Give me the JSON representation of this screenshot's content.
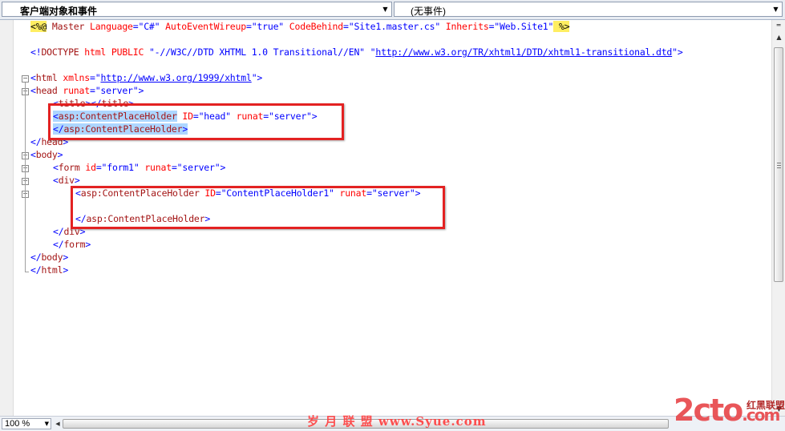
{
  "navbar": {
    "left_dropdown": "客户端对象和事件",
    "right_dropdown": "(无事件)"
  },
  "code": {
    "line1": {
      "open": "<%@",
      "directive": " Master",
      "a1": " Language",
      "v1": "=\"C#\"",
      "a2": " AutoEventWireup",
      "v2": "=\"true\"",
      "a3": " CodeBehind",
      "v3": "=\"Site1.master.cs\"",
      "a4": " Inherits",
      "v4": "=\"Web.Site1\"",
      "close": " %>"
    },
    "line3": {
      "prefix": "<!",
      "tag": "DOCTYPE",
      "rest1": " html",
      "rest2": " PUBLIC",
      "str1": " \"-//W3C//DTD XHTML 1.0 Transitional//EN\"",
      "q_open": " \"",
      "url": "http://www.w3.org/TR/xhtml1/DTD/xhtml1-transitional.dtd",
      "q_close": "\">"
    },
    "line5": {
      "open": "<",
      "tag": "html",
      "attr": " xmlns",
      "eq": "=\"",
      "url": "http://www.w3.org/1999/xhtml",
      "close": "\">"
    },
    "line6": {
      "open": "<",
      "tag": "head",
      "attr": " runat",
      "val": "=\"server\"",
      "close": ">"
    },
    "line7": {
      "open": "<",
      "tag": "title",
      "mid": "></",
      "tag2": "title",
      "close": ">"
    },
    "line8": {
      "open": "<",
      "ns": "asp:",
      "tag": "ContentPlaceHolder",
      "a1": " ID",
      "v1": "=\"head\"",
      "a2": " runat",
      "v2": "=\"server\"",
      "close": ">"
    },
    "line9": {
      "open": "</",
      "ns": "asp:",
      "tag": "ContentPlaceHolder",
      "close": ">"
    },
    "line10": {
      "open": "</",
      "tag": "head",
      "close": ">"
    },
    "line11": {
      "open": "<",
      "tag": "body",
      "close": ">"
    },
    "line12": {
      "open": "<",
      "tag": "form",
      "a1": " id",
      "v1": "=\"form1\"",
      "a2": " runat",
      "v2": "=\"server\"",
      "close": ">"
    },
    "line13": {
      "open": "<",
      "tag": "div",
      "close": ">"
    },
    "line14": {
      "open": "<",
      "ns": "asp:",
      "tag": "ContentPlaceHolder",
      "a1": " ID",
      "v1": "=\"ContentPlaceHolder1\"",
      "a2": " runat",
      "v2": "=\"server\"",
      "close": ">"
    },
    "line16": {
      "open": "</",
      "ns": "asp:",
      "tag": "ContentPlaceHolder",
      "close": ">"
    },
    "line17": {
      "open": "</",
      "tag": "div",
      "close": ">"
    },
    "line18": {
      "open": "</",
      "tag": "form",
      "close": ">"
    },
    "line19": {
      "open": "</",
      "tag": "body",
      "close": ">"
    },
    "line20": {
      "open": "</",
      "tag": "html",
      "close": ">"
    }
  },
  "colors": {
    "tag_bracket": "#0000ff",
    "tag_name": "#a31515",
    "attribute": "#ff0000",
    "value": "#0000ff",
    "directive_highlight": "#ffee62",
    "highlight_box": "#e32222"
  },
  "statusbar": {
    "zoom": "100 %"
  },
  "watermark": {
    "center": "岁 月 联 盟  www.Syue.com",
    "logo": "2cto",
    "logo_suffix": ".com",
    "logo_cn": "红黑联盟"
  }
}
